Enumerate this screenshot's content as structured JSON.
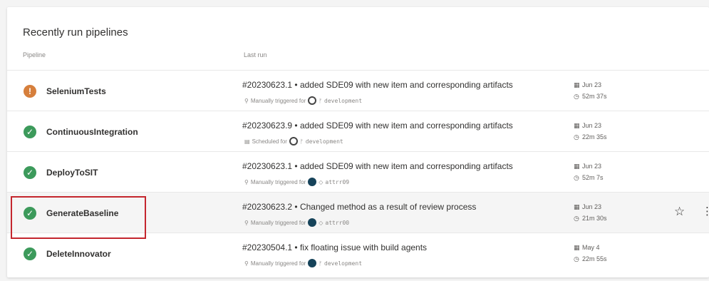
{
  "panel": {
    "title": "Recently run pipelines",
    "col_pipeline": "Pipeline",
    "col_last_run": "Last run"
  },
  "colors": {
    "success": "#3c9a5b",
    "warning": "#d67f3c",
    "highlight": "#c4262e"
  },
  "rows": [
    {
      "name": "SeleniumTests",
      "status": "warning",
      "status_icon": "warning-icon",
      "run_title": "#20230623.1 • added SDE09 with new item and corresponding artifacts",
      "trigger": "Manually triggered for",
      "branch": "development",
      "date": "Jun 23",
      "duration": "52m 37s"
    },
    {
      "name": "ContinuousIntegration",
      "status": "success",
      "status_icon": "check-icon",
      "run_title": "#20230623.9 • added SDE09 with new item and corresponding artifacts",
      "trigger": "Scheduled for",
      "branch": "development",
      "date": "Jun 23",
      "duration": "22m 35s"
    },
    {
      "name": "DeployToSIT",
      "status": "success",
      "status_icon": "check-icon",
      "run_title": "#20230623.1 • added SDE09 with new item and corresponding artifacts",
      "trigger": "Manually triggered for",
      "branch": "attrr09",
      "date": "Jun 23",
      "duration": "52m 7s"
    },
    {
      "name": "GenerateBaseline",
      "status": "success",
      "status_icon": "check-icon",
      "run_title": "#20230623.2 • Changed method as a result of review process",
      "trigger": "Manually triggered for",
      "branch": "attrr00",
      "date": "Jun 23",
      "duration": "21m 30s"
    },
    {
      "name": "DeleteInnovator",
      "status": "success",
      "status_icon": "check-icon",
      "run_title": "#20230504.1 • fix floating issue with build agents",
      "trigger": "Manually triggered for",
      "branch": "development",
      "date": "May 4",
      "duration": "22m 55s"
    }
  ],
  "icons": {
    "trigger": "trigger-icon",
    "branch": "branch-icon",
    "calendar": "calendar-icon",
    "clock": "clock-icon",
    "star": "star-icon",
    "more": "more-icon"
  }
}
